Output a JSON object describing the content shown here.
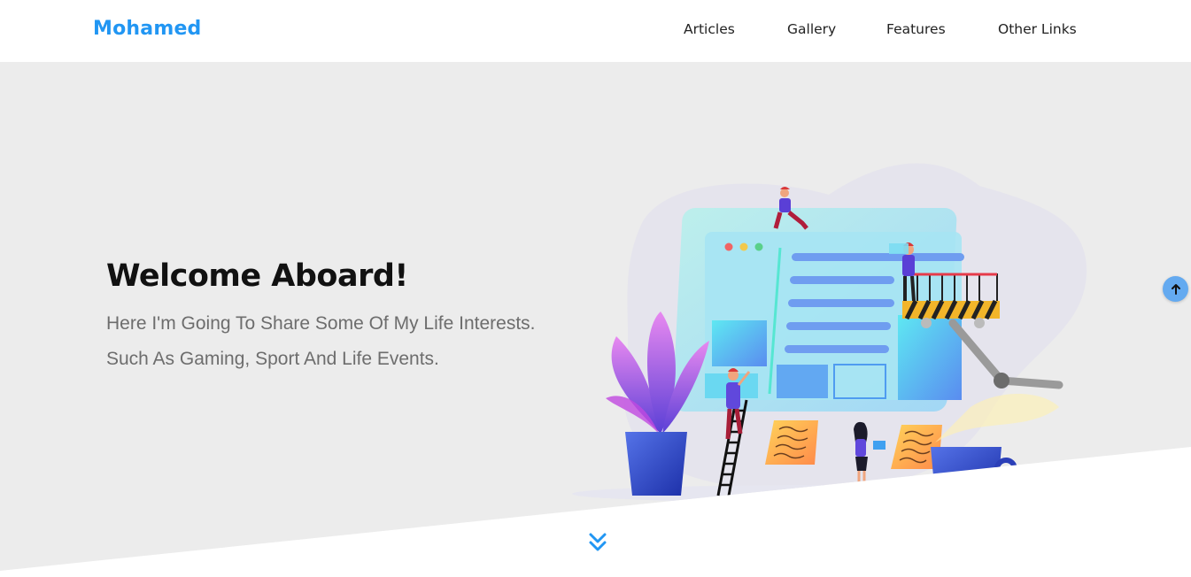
{
  "header": {
    "logo": "Mohamed",
    "nav": [
      {
        "label": "Articles"
      },
      {
        "label": "Gallery"
      },
      {
        "label": "Features"
      },
      {
        "label": "Other Links"
      }
    ]
  },
  "hero": {
    "title": "Welcome Aboard!",
    "description": "Here I'm Going To Share Some Of My Life Interests. Such As Gaming, Sport And Life Events."
  },
  "icons": {
    "scroll_top": "arrow-up-icon",
    "scroll_down": "double-chevron-down-icon"
  },
  "colors": {
    "accent": "#2196f3",
    "hero_background": "#ececec",
    "scroll_top_button": "#64aaf0"
  }
}
